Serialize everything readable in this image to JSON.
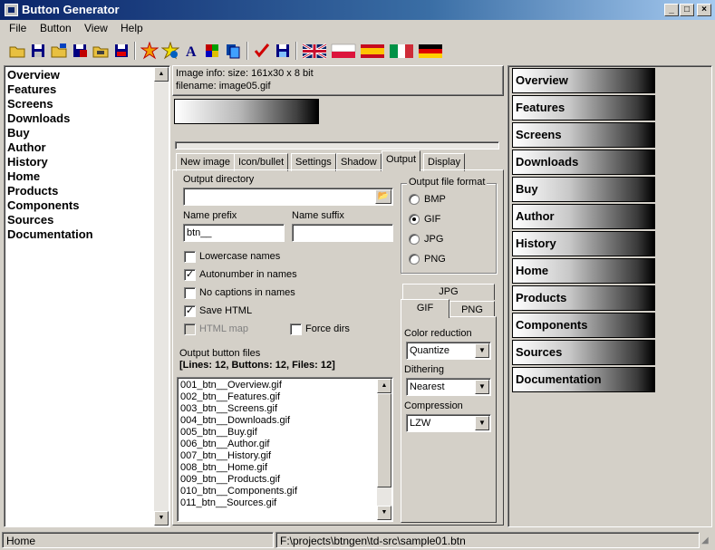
{
  "window": {
    "title": "Button Generator"
  },
  "menu": [
    "File",
    "Button",
    "View",
    "Help"
  ],
  "toolbar": {
    "icons": [
      "open-folder-icon",
      "save-icon",
      "open-icon",
      "save-all-icon",
      "open-template-icon",
      "save-template-icon",
      "generate-icon",
      "generate-all-icon",
      "font-icon",
      "colors-icon",
      "palette-icon",
      "check-icon",
      "save-output-icon"
    ],
    "flags": [
      "flag-uk-icon",
      "flag-poland-icon",
      "flag-spain-icon",
      "flag-italy-icon",
      "flag-germany-icon"
    ]
  },
  "left_list": [
    "Overview",
    "Features",
    "Screens",
    "Downloads",
    "Buy",
    "Author",
    "History",
    "Home",
    "Products",
    "Components",
    "Sources",
    "Documentation"
  ],
  "image_info": {
    "line1": "Image info: size: 161x30 x 8 bit",
    "line2": "filename: image05.gif"
  },
  "tabs": [
    "New image",
    "Icon/bullet",
    "Settings",
    "Shadow",
    "Output",
    "Display"
  ],
  "active_tab": "Output",
  "output": {
    "dir_label": "Output directory",
    "dir_value": "",
    "prefix_label": "Name prefix",
    "prefix_value": "btn__",
    "suffix_label": "Name suffix",
    "suffix_value": "",
    "checkboxes": [
      {
        "label": "Lowercase names",
        "checked": false,
        "disabled": false
      },
      {
        "label": "Autonumber in names",
        "checked": true,
        "disabled": false
      },
      {
        "label": "No captions in names",
        "checked": false,
        "disabled": false
      },
      {
        "label": "Save HTML",
        "checked": true,
        "disabled": false
      },
      {
        "label": "HTML map",
        "checked": false,
        "disabled": true
      }
    ],
    "force_dirs_label": "Force dirs",
    "files_label": "Output button files",
    "files_summary": "[Lines: 12, Buttons: 12, Files: 12]",
    "files": [
      "001_btn__Overview.gif",
      "002_btn__Features.gif",
      "003_btn__Screens.gif",
      "004_btn__Downloads.gif",
      "005_btn__Buy.gif",
      "006_btn__Author.gif",
      "007_btn__History.gif",
      "008_btn__Home.gif",
      "009_btn__Products.gif",
      "010_btn__Components.gif",
      "011_btn__Sources.gif"
    ]
  },
  "format": {
    "group_label": "Output file format",
    "options": [
      "BMP",
      "GIF",
      "JPG",
      "PNG"
    ],
    "selected": "GIF"
  },
  "subtabs": {
    "top": "JPG",
    "left": "GIF",
    "right": "PNG",
    "color_reduction_label": "Color reduction",
    "color_reduction": "Quantize",
    "dithering_label": "Dithering",
    "dithering": "Nearest",
    "compression_label": "Compression",
    "compression": "LZW"
  },
  "buttons": [
    "Overview",
    "Features",
    "Screens",
    "Downloads",
    "Buy",
    "Author",
    "History",
    "Home",
    "Products",
    "Components",
    "Sources",
    "Documentation"
  ],
  "status": {
    "left": "Home",
    "path": "F:\\projects\\btngen\\td-src\\sample01.btn"
  }
}
